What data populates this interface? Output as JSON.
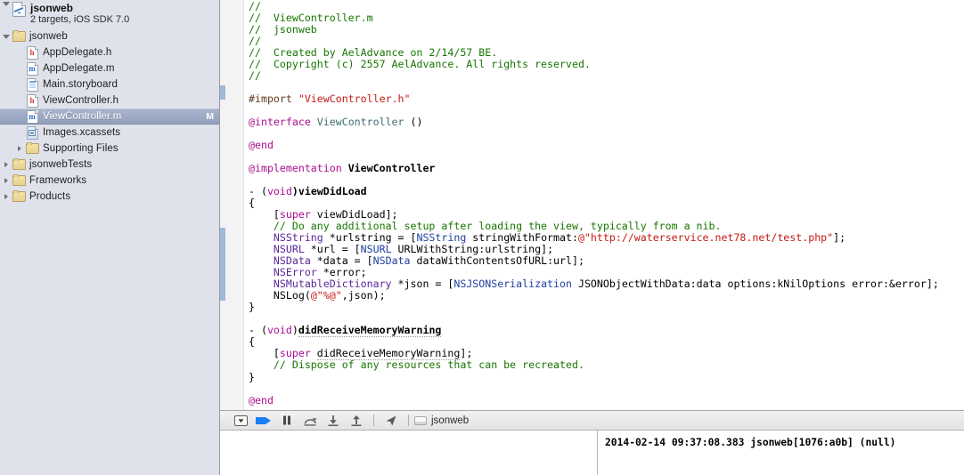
{
  "navigator": {
    "project": {
      "name": "jsonweb",
      "subtitle": "2 targets, iOS SDK 7.0",
      "icon": "xcode-project-icon"
    },
    "items": [
      {
        "label": "jsonweb",
        "icon": "folder-icon",
        "indent": 1,
        "twist": "open",
        "badge": ""
      },
      {
        "label": "AppDelegate.h",
        "icon": "header-file-icon",
        "indent": 2,
        "twist": "none",
        "badge": ""
      },
      {
        "label": "AppDelegate.m",
        "icon": "implementation-file-icon",
        "indent": 2,
        "twist": "none",
        "badge": ""
      },
      {
        "label": "Main.storyboard",
        "icon": "storyboard-file-icon",
        "indent": 2,
        "twist": "none",
        "badge": ""
      },
      {
        "label": "ViewController.h",
        "icon": "header-file-icon",
        "indent": 2,
        "twist": "none",
        "badge": ""
      },
      {
        "label": "ViewController.m",
        "icon": "implementation-file-icon",
        "indent": 2,
        "twist": "none",
        "badge": "M",
        "selected": true
      },
      {
        "label": "Images.xcassets",
        "icon": "asset-catalog-icon",
        "indent": 2,
        "twist": "none",
        "badge": ""
      },
      {
        "label": "Supporting Files",
        "icon": "folder-icon",
        "indent": 2,
        "twist": "closed",
        "badge": ""
      },
      {
        "label": "jsonwebTests",
        "icon": "folder-icon",
        "indent": 1,
        "twist": "closed",
        "badge": ""
      },
      {
        "label": "Frameworks",
        "icon": "folder-icon",
        "indent": 1,
        "twist": "closed",
        "badge": ""
      },
      {
        "label": "Products",
        "icon": "folder-icon",
        "indent": 1,
        "twist": "closed",
        "badge": ""
      }
    ]
  },
  "editor": {
    "filename": "ViewController.m",
    "lines": [
      [
        {
          "t": "//",
          "c": "c-com"
        }
      ],
      [
        {
          "t": "//  ViewController.m",
          "c": "c-com"
        }
      ],
      [
        {
          "t": "//  jsonweb",
          "c": "c-com"
        }
      ],
      [
        {
          "t": "//",
          "c": "c-com"
        }
      ],
      [
        {
          "t": "//  Created by AelAdvance on 2/14/57 BE.",
          "c": "c-com"
        }
      ],
      [
        {
          "t": "//  Copyright (c) 2557 AelAdvance. All rights reserved.",
          "c": "c-com"
        }
      ],
      [
        {
          "t": "//",
          "c": "c-com"
        }
      ],
      [],
      [
        {
          "t": "#import ",
          "c": "c-pre"
        },
        {
          "t": "\"ViewController.h\"",
          "c": "c-str"
        }
      ],
      [],
      [
        {
          "t": "@interface",
          "c": "c-key"
        },
        {
          "t": " ",
          "c": "c-plain"
        },
        {
          "t": "ViewController",
          "c": "c-cls"
        },
        {
          "t": " ()",
          "c": "c-plain"
        }
      ],
      [],
      [
        {
          "t": "@end",
          "c": "c-key"
        }
      ],
      [],
      [
        {
          "t": "@implementation",
          "c": "c-key"
        },
        {
          "t": " ",
          "c": "c-plain"
        },
        {
          "t": "ViewController",
          "c": "c-plain c-bold"
        }
      ],
      [],
      [
        {
          "t": "- (",
          "c": "c-plain"
        },
        {
          "t": "void",
          "c": "c-key"
        },
        {
          "t": ")viewDidLoad",
          "c": "c-plain c-bold"
        }
      ],
      [
        {
          "t": "{",
          "c": "c-plain"
        }
      ],
      [
        {
          "t": "    [",
          "c": "c-plain"
        },
        {
          "t": "super",
          "c": "c-key"
        },
        {
          "t": " viewDidLoad];",
          "c": "c-plain"
        }
      ],
      [
        {
          "t": "    // Do any additional setup after loading the view, typically from a nib.",
          "c": "c-com"
        }
      ],
      [
        {
          "t": "    ",
          "c": "c-plain"
        },
        {
          "t": "NSString",
          "c": "c-type"
        },
        {
          "t": " *urlstring = [",
          "c": "c-plain"
        },
        {
          "t": "NSString",
          "c": "c-meth"
        },
        {
          "t": " stringWithFormat:",
          "c": "c-plain"
        },
        {
          "t": "@\"http://waterservice.net78.net/test.php\"",
          "c": "c-str"
        },
        {
          "t": "];",
          "c": "c-plain"
        }
      ],
      [
        {
          "t": "    ",
          "c": "c-plain"
        },
        {
          "t": "NSURL",
          "c": "c-type"
        },
        {
          "t": " *url = [",
          "c": "c-plain"
        },
        {
          "t": "NSURL",
          "c": "c-meth"
        },
        {
          "t": " URLWithString:urlstring];",
          "c": "c-plain"
        }
      ],
      [
        {
          "t": "    ",
          "c": "c-plain"
        },
        {
          "t": "NSData",
          "c": "c-type"
        },
        {
          "t": " *data = [",
          "c": "c-plain"
        },
        {
          "t": "NSData",
          "c": "c-meth"
        },
        {
          "t": " dataWithContentsOfURL:url];",
          "c": "c-plain"
        }
      ],
      [
        {
          "t": "    ",
          "c": "c-plain"
        },
        {
          "t": "NSError",
          "c": "c-type"
        },
        {
          "t": " *error;",
          "c": "c-plain"
        }
      ],
      [
        {
          "t": "    ",
          "c": "c-plain"
        },
        {
          "t": "NSMutableDictionary",
          "c": "c-type"
        },
        {
          "t": " *json = [",
          "c": "c-plain"
        },
        {
          "t": "NSJSONSerialization",
          "c": "c-meth"
        },
        {
          "t": " JSONObjectWithData:data options:kNilOptions error:&error];",
          "c": "c-plain"
        }
      ],
      [
        {
          "t": "    NSLog(",
          "c": "c-plain"
        },
        {
          "t": "@\"%@\"",
          "c": "c-str"
        },
        {
          "t": ",json);",
          "c": "c-plain"
        }
      ],
      [
        {
          "t": "}",
          "c": "c-plain"
        }
      ],
      [],
      [
        {
          "t": "- (",
          "c": "c-plain"
        },
        {
          "t": "void",
          "c": "c-key"
        },
        {
          "t": ")",
          "c": "c-plain"
        },
        {
          "t": "didReceiveMemoryWarning",
          "c": "c-plain c-bold sp-underline"
        }
      ],
      [
        {
          "t": "{",
          "c": "c-plain"
        }
      ],
      [
        {
          "t": "    [",
          "c": "c-plain"
        },
        {
          "t": "super",
          "c": "c-key"
        },
        {
          "t": " ",
          "c": "c-plain"
        },
        {
          "t": "didReceiveMemoryWarning",
          "c": "c-plain sp-underline"
        },
        {
          "t": "];",
          "c": "c-plain"
        }
      ],
      [
        {
          "t": "    // Dispose of any resources that can be recreated.",
          "c": "c-com"
        }
      ],
      [
        {
          "t": "}",
          "c": "c-plain"
        }
      ],
      [],
      [
        {
          "t": "@end",
          "c": "c-key"
        }
      ]
    ]
  },
  "debug_bar": {
    "buttons": [
      {
        "name": "hide-debug-area-button",
        "icon": "triangle-in-box-icon"
      },
      {
        "name": "continue-button",
        "icon": "continue-arrow-icon"
      },
      {
        "name": "pause-button",
        "icon": "pause-icon"
      },
      {
        "name": "step-over-button",
        "icon": "step-over-icon"
      },
      {
        "name": "step-into-button",
        "icon": "step-into-icon"
      },
      {
        "name": "step-out-button",
        "icon": "step-out-icon"
      },
      {
        "name": "simulate-location-button",
        "icon": "location-arrow-icon"
      }
    ],
    "breadcrumb": "jsonweb"
  },
  "console": {
    "output": "2014-02-14 09:37:08.383 jsonweb[1076:a0b] (null)"
  },
  "colors": {
    "sidebar_bg": "#dfe2ea",
    "selection": "#93a0bd",
    "comment": "#177500",
    "string": "#c41a16",
    "keyword": "#aa0d91",
    "type": "#5c2699",
    "method": "#2040a0",
    "accent_blue": "#1a7ef4"
  }
}
